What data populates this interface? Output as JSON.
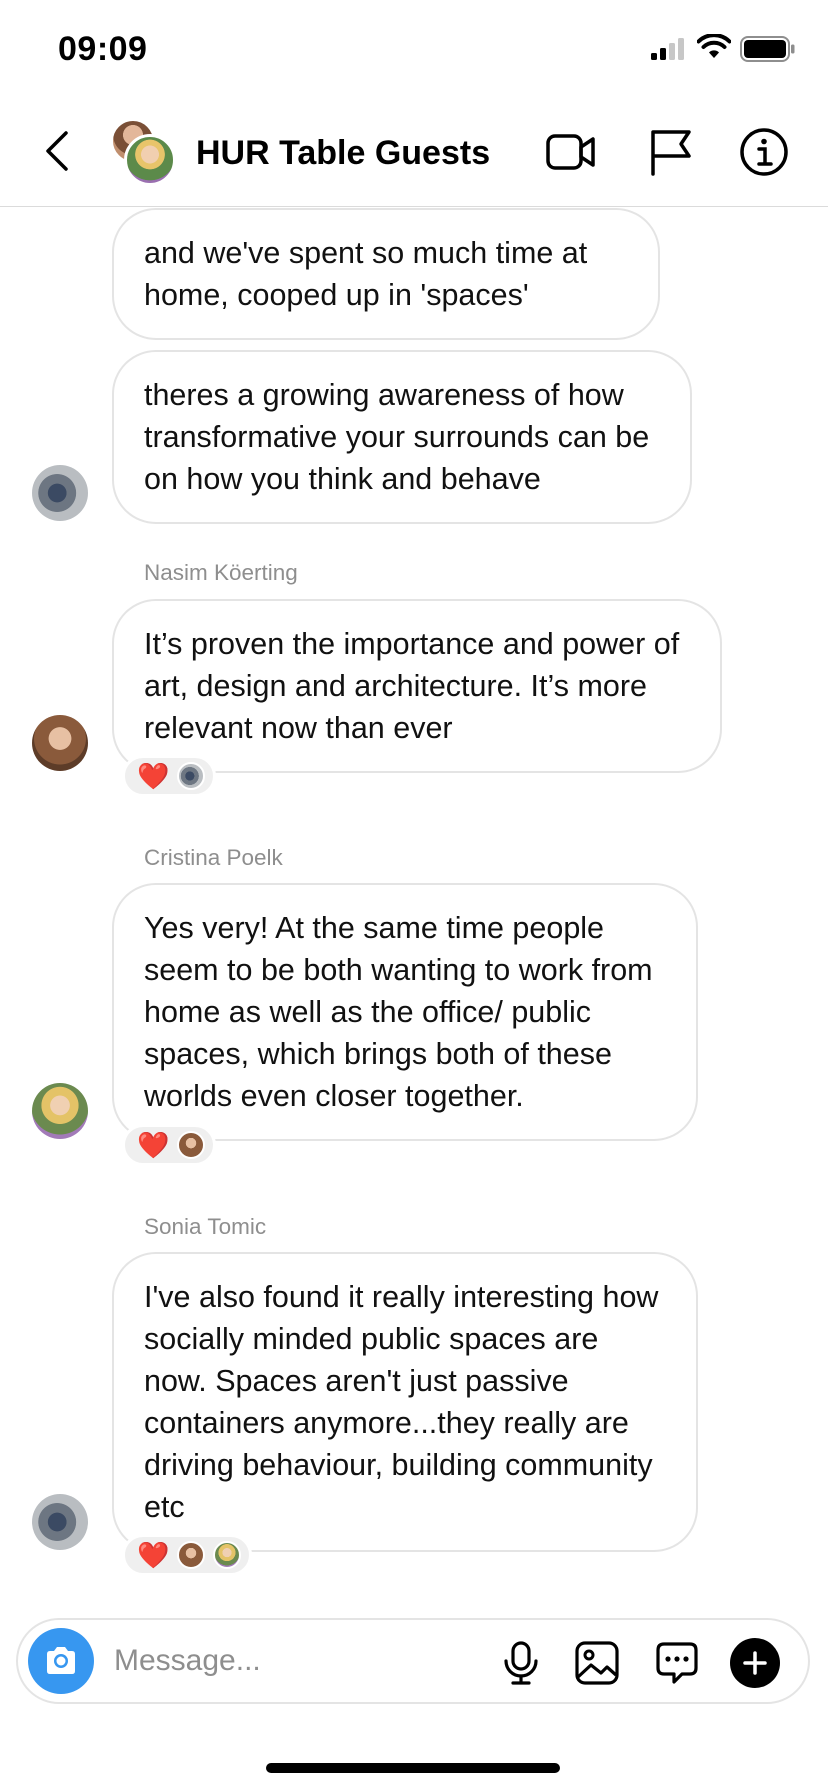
{
  "status_bar": {
    "time": "09:09"
  },
  "header": {
    "title": "HUR Table Guests"
  },
  "messages": [
    {
      "text": "and we've spent so much time at home, cooped up in 'spaces'"
    },
    {
      "text": "theres a growing awareness of how transformative your surrounds can be on how you think and behave"
    },
    {
      "sender": "Nasim Köerting",
      "text": "It’s proven the importance and power of art, design and architecture. It’s more relevant now than ever",
      "reaction": "❤️"
    },
    {
      "sender": "Cristina Poelk",
      "text": "Yes very! At the same time people seem to be both wanting to work from home as well as the office/ public spaces, which brings both of these worlds even closer together.",
      "reaction": "❤️"
    },
    {
      "sender": "Sonia Tomic",
      "text": "I've also found it really interesting how socially minded public spaces are now.  Spaces aren't just passive containers anymore...they really are driving behaviour, building community etc",
      "reaction": "❤️"
    }
  ],
  "composer": {
    "placeholder": "Message..."
  },
  "colors": {
    "accent": "#3797f0",
    "heart": "#ed2a3a",
    "meta_text": "#8e8e8e",
    "border": "#e4e4e4"
  }
}
